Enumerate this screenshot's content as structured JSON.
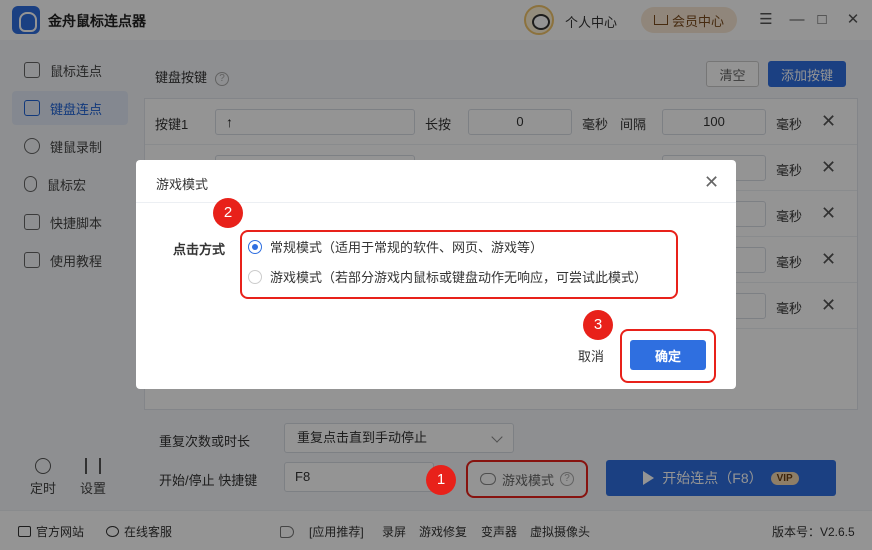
{
  "app": {
    "title": "金舟鼠标连点器",
    "user_center": "个人中心",
    "vip_center": "会员中心"
  },
  "window_controls": [
    "☰",
    "—",
    "□",
    "✕"
  ],
  "sidebar": {
    "items": [
      {
        "label": "鼠标连点",
        "icon": "mouse-click-icon",
        "active": false
      },
      {
        "label": "键盘连点",
        "icon": "keyboard-icon",
        "active": true
      },
      {
        "label": "键鼠录制",
        "icon": "record-icon",
        "active": false
      },
      {
        "label": "鼠标宏",
        "icon": "mouse-icon",
        "active": false
      },
      {
        "label": "快捷脚本",
        "icon": "script-icon",
        "active": false
      },
      {
        "label": "使用教程",
        "icon": "tutorial-icon",
        "active": false
      }
    ],
    "timer": "定时",
    "settings": "设置"
  },
  "keyboard": {
    "label": "键盘按键",
    "clear": "清空",
    "add": "添加按键"
  },
  "rows": [
    {
      "label": "按键1",
      "key": "↑",
      "press": "长按",
      "press_value": "0",
      "unit": "毫秒",
      "interval": "间隔",
      "interval_value": "100"
    },
    {
      "label": "",
      "key": "",
      "press": "",
      "press_value": "",
      "unit": "毫秒",
      "interval": "",
      "interval_value": ""
    },
    {
      "label": "",
      "key": "",
      "press": "",
      "press_value": "",
      "unit": "毫秒",
      "interval": "",
      "interval_value": ""
    },
    {
      "label": "",
      "key": "",
      "press": "",
      "press_value": "",
      "unit": "毫秒",
      "interval": "",
      "interval_value": ""
    },
    {
      "label": "",
      "key": "",
      "press": "",
      "press_value": "",
      "unit": "毫秒",
      "interval": "",
      "interval_value": ""
    }
  ],
  "settings": {
    "repeat_label": "重复次数或时长",
    "repeat_value": "重复点击直到手动停止",
    "hotkey_label": "开始/停止 快捷键",
    "hotkey_value": "F8",
    "game_mode": "游戏模式",
    "start": "开始连点（F8）",
    "vip_badge": "VIP"
  },
  "footer": {
    "website": "官方网站",
    "support": "在线客服",
    "recommend": "[应用推荐]",
    "links": [
      "录屏",
      "游戏修复",
      "变声器",
      "虚拟摄像头"
    ],
    "version": "版本号：V2.6.5"
  },
  "dialog": {
    "title": "游戏模式",
    "click_method_label": "点击方式",
    "options": [
      {
        "label": "常规模式（适用于常规的软件、网页、游戏等）",
        "selected": true
      },
      {
        "label": "游戏模式（若部分游戏内鼠标或键盘动作无响应，可尝试此模式）",
        "selected": false
      }
    ],
    "cancel": "取消",
    "confirm": "确定"
  },
  "annotations": {
    "marker_1": "1",
    "marker_2": "2",
    "marker_3": "3",
    "color": "#e8211a"
  },
  "colors": {
    "accent": "#2f6fe0",
    "sidebar_active_bg": "#e3ebf8"
  }
}
